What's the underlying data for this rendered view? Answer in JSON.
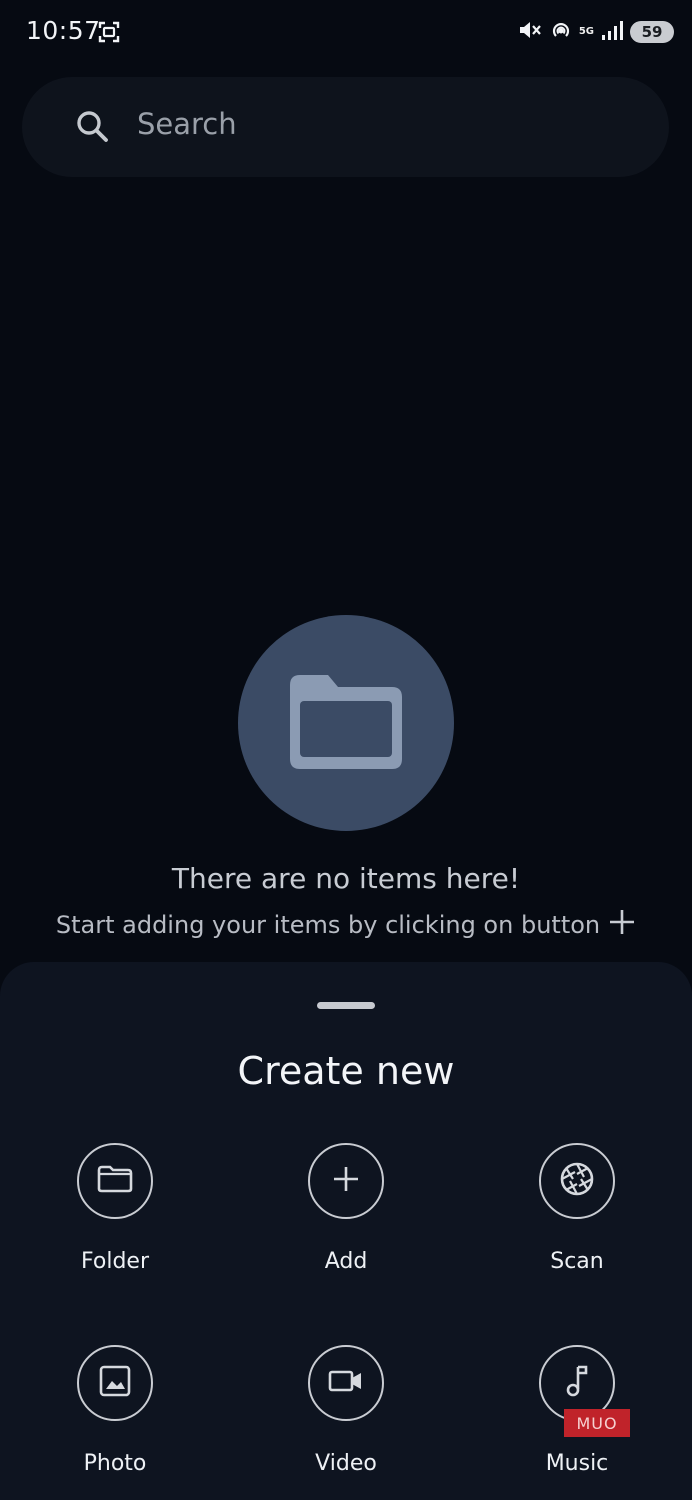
{
  "status_bar": {
    "time": "10:57",
    "network": "5G",
    "battery": "59"
  },
  "search": {
    "placeholder": "Search"
  },
  "empty_state": {
    "title": "There are no items here!",
    "subtitle": "Start adding your items by clicking on button"
  },
  "sheet": {
    "title": "Create new",
    "actions": [
      {
        "label": "Folder",
        "icon": "folder-icon"
      },
      {
        "label": "Add",
        "icon": "plus-icon"
      },
      {
        "label": "Scan",
        "icon": "aperture-icon"
      },
      {
        "label": "Photo",
        "icon": "image-icon"
      },
      {
        "label": "Video",
        "icon": "video-camera-icon"
      },
      {
        "label": "Music",
        "icon": "music-note-icon"
      }
    ]
  },
  "watermark": "MUO",
  "colors": {
    "background": "#060a12",
    "sheet": "#0e1420",
    "empty_circle": "#3b4b65"
  }
}
